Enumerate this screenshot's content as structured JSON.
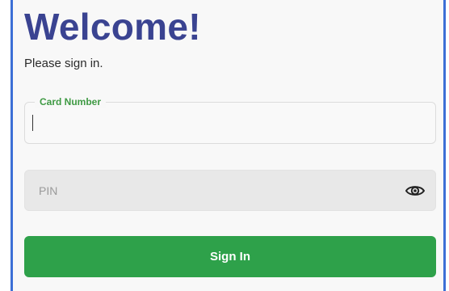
{
  "header": {
    "title": "Welcome!",
    "subtitle": "Please sign in."
  },
  "form": {
    "card_number": {
      "label": "Card Number",
      "value": ""
    },
    "pin": {
      "placeholder": "PIN",
      "value": "",
      "toggle_icon": "eye-icon"
    },
    "submit_label": "Sign In"
  },
  "colors": {
    "title": "#3a4391",
    "accent_green": "#2ea14a",
    "label_green": "#3f9a44",
    "frame_border": "#3c6fd6"
  }
}
